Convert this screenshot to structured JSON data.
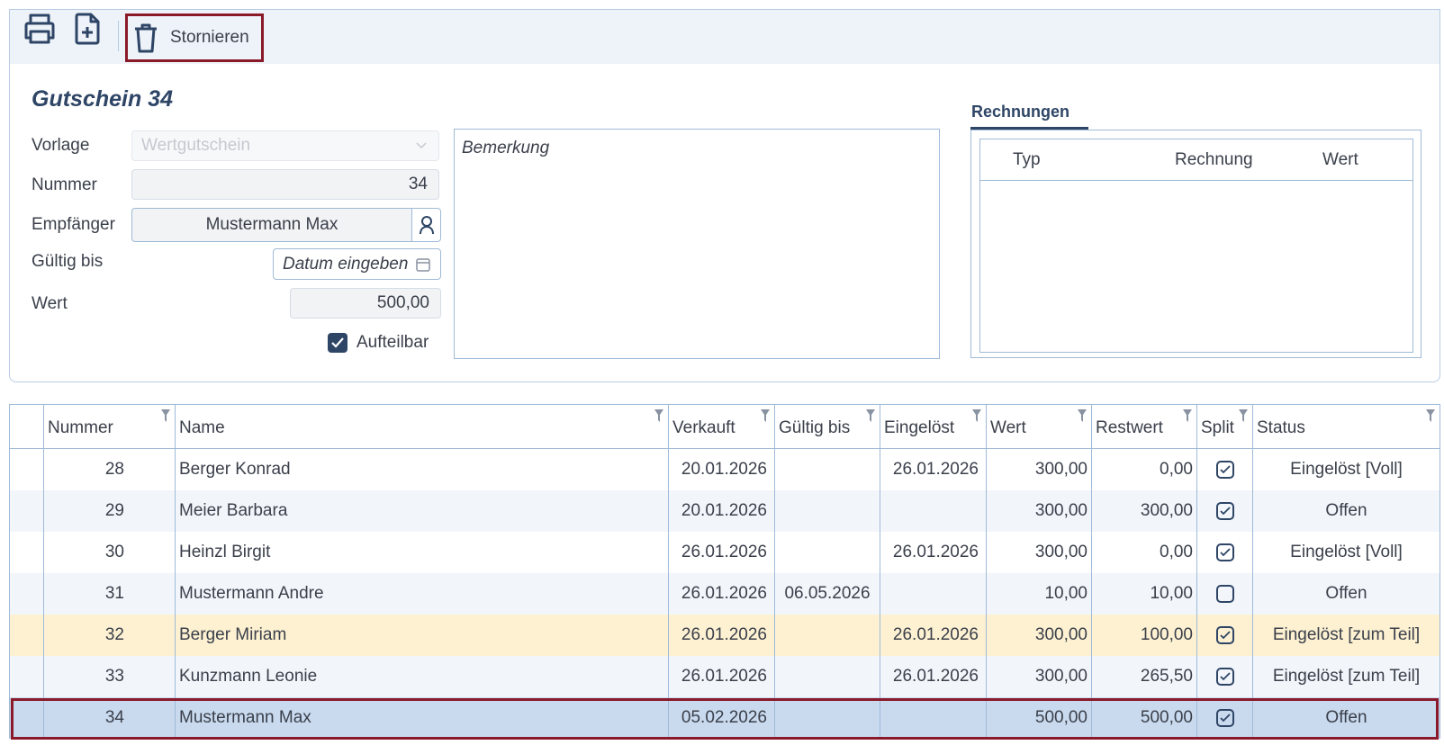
{
  "toolbar": {
    "print_icon": "printer-icon",
    "new_icon": "new-document-icon",
    "cancel_icon": "trash-icon",
    "cancel_label": "Stornieren"
  },
  "form": {
    "title": "Gutschein 34",
    "vorlage_label": "Vorlage",
    "vorlage_value": "Wertgutschein",
    "nummer_label": "Nummer",
    "nummer_value": "34",
    "empfaenger_label": "Empfänger",
    "empfaenger_value": "Mustermann Max",
    "gueltig_label": "Gültig bis",
    "gueltig_placeholder": "Datum eingeben",
    "wert_label": "Wert",
    "wert_value": "500,00",
    "aufteilbar_label": "Aufteilbar",
    "aufteilbar_checked": true,
    "bemerkung_placeholder": "Bemerkung"
  },
  "rechnungen": {
    "tab_label": "Rechnungen",
    "columns": [
      "Typ",
      "Rechnung",
      "Wert"
    ]
  },
  "grid": {
    "columns": [
      "Nummer",
      "Name",
      "Verkauft",
      "Gültig bis",
      "Eingelöst",
      "Wert",
      "Restwert",
      "Split",
      "Status"
    ],
    "rows": [
      {
        "nummer": "28",
        "name": "Berger Konrad",
        "verkauft": "20.01.2026",
        "gueltig": "",
        "eingeloest": "26.01.2026",
        "wert": "300,00",
        "restwert": "0,00",
        "split": true,
        "status": "Eingelöst [Voll]"
      },
      {
        "nummer": "29",
        "name": "Meier Barbara",
        "verkauft": "20.01.2026",
        "gueltig": "",
        "eingeloest": "",
        "wert": "300,00",
        "restwert": "300,00",
        "split": true,
        "status": "Offen"
      },
      {
        "nummer": "30",
        "name": "Heinzl Birgit",
        "verkauft": "26.01.2026",
        "gueltig": "",
        "eingeloest": "26.01.2026",
        "wert": "300,00",
        "restwert": "0,00",
        "split": true,
        "status": "Eingelöst [Voll]"
      },
      {
        "nummer": "31",
        "name": "Mustermann Andre",
        "verkauft": "26.01.2026",
        "gueltig": "06.05.2026",
        "eingeloest": "",
        "wert": "10,00",
        "restwert": "10,00",
        "split": false,
        "status": "Offen"
      },
      {
        "nummer": "32",
        "name": "Berger Miriam",
        "verkauft": "26.01.2026",
        "gueltig": "",
        "eingeloest": "26.01.2026",
        "wert": "300,00",
        "restwert": "100,00",
        "split": true,
        "status": "Eingelöst [zum Teil]"
      },
      {
        "nummer": "33",
        "name": "Kunzmann Leonie",
        "verkauft": "26.01.2026",
        "gueltig": "",
        "eingeloest": "26.01.2026",
        "wert": "300,00",
        "restwert": "265,50",
        "split": true,
        "status": "Eingelöst [zum Teil]"
      },
      {
        "nummer": "34",
        "name": "Mustermann Max",
        "verkauft": "05.02.2026",
        "gueltig": "",
        "eingeloest": "",
        "wert": "500,00",
        "restwert": "500,00",
        "split": true,
        "status": "Offen"
      }
    ],
    "row_colors": [
      "#ffffff",
      "#f2f6fb",
      "#ffffff",
      "#f2f6fb",
      "#fdf1d2",
      "#f2f6fb",
      "#c9daee"
    ]
  },
  "colors": {
    "accent": "#2e4566",
    "border": "#9fbad8",
    "highlight": "#8a1a2a"
  }
}
